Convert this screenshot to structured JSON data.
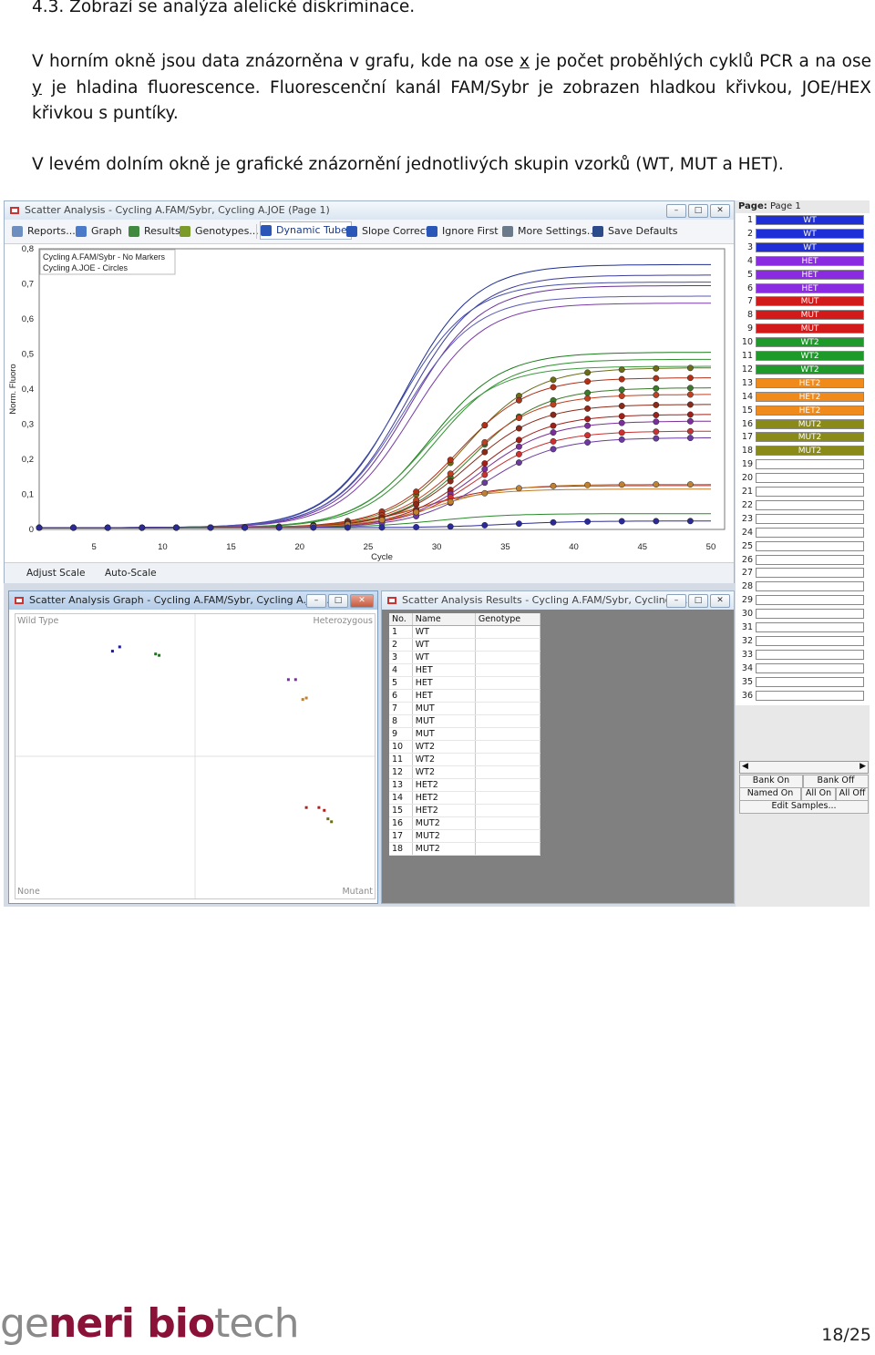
{
  "heading": "4.3.  Zobrazí se analýza alelické diskriminace.",
  "para1": {
    "a": "V horním okně jsou data znázorněna v grafu, kde na ose ",
    "x": "x",
    "b": " je počet proběhlých cyklů PCR a na ose ",
    "y": "y",
    "c": " je hladina fluorescence. Fluorescenční kanál FAM/Sybr je zobrazen hladkou křivkou, JOE/HEX křivkou s puntíky."
  },
  "para2": "V levém dolním okně je grafické znázornění jednotlivých skupin vzorků (WT, MUT a HET).",
  "main_window": {
    "title": "Scatter Analysis - Cycling A.FAM/Sybr, Cycling A.JOE (Page 1)",
    "toolbar": [
      "Reports...",
      "Graph",
      "Results",
      "Genotypes...",
      "Dynamic Tube",
      "Slope Correct",
      "Ignore First",
      "More Settings...",
      "Save Defaults"
    ],
    "legend": [
      "Cycling A.FAM/Sybr - No Markers",
      "Cycling A.JOE - Circles"
    ],
    "adjust_scale": "Adjust Scale",
    "auto_scale": "Auto-Scale"
  },
  "chart_data": {
    "type": "line",
    "xlabel": "Cycle",
    "ylabel": "Norm. Fluoro",
    "xlim": [
      1,
      51
    ],
    "ylim": [
      0,
      0.8
    ],
    "x_ticks": [
      "5",
      "10",
      "15",
      "20",
      "25",
      "30",
      "35",
      "40",
      "45",
      "50"
    ],
    "y_ticks": [
      "0",
      "0,1",
      "0,2",
      "0,3",
      "0,4",
      "0,5",
      "0,6",
      "0,7",
      "0,8"
    ],
    "fam_curves": [
      {
        "color": "#1f2f8f",
        "plateau": 0.75,
        "mid": 27.5
      },
      {
        "color": "#3b3b9a",
        "plateau": 0.72,
        "mid": 27.8
      },
      {
        "color": "#444ea8",
        "plateau": 0.7,
        "mid": 27.2
      },
      {
        "color": "#6a2f9a",
        "plateau": 0.69,
        "mid": 28.0
      },
      {
        "color": "#5a5ab5",
        "plateau": 0.66,
        "mid": 27.6
      },
      {
        "color": "#7a3aa8",
        "plateau": 0.64,
        "mid": 28.2
      },
      {
        "color": "#1a7a1a",
        "plateau": 0.5,
        "mid": 29.5
      },
      {
        "color": "#2f8f2f",
        "plateau": 0.48,
        "mid": 29.8
      },
      {
        "color": "#3d9a3d",
        "plateau": 0.46,
        "mid": 29.2
      },
      {
        "color": "#b02020",
        "plateau": 0.12,
        "mid": 29.0
      },
      {
        "color": "#c07a20",
        "plateau": 0.11,
        "mid": 28.5
      },
      {
        "color": "#2a8a2a",
        "plateau": 0.04,
        "mid": 30.0
      }
    ],
    "joe_curves": [
      {
        "color": "#6b6b18",
        "plateau": 0.48,
        "mid": 32.0
      },
      {
        "color": "#b03018",
        "plateau": 0.45,
        "mid": 31.5
      },
      {
        "color": "#3a7a2a",
        "plateau": 0.42,
        "mid": 32.5
      },
      {
        "color": "#c04020",
        "plateau": 0.4,
        "mid": 32.0
      },
      {
        "color": "#8a2a18",
        "plateau": 0.37,
        "mid": 32.3
      },
      {
        "color": "#a02018",
        "plateau": 0.34,
        "mid": 32.8
      },
      {
        "color": "#7a2f9a",
        "plateau": 0.32,
        "mid": 33.0
      },
      {
        "color": "#cc3030",
        "plateau": 0.29,
        "mid": 33.0
      },
      {
        "color": "#6a3aa0",
        "plateau": 0.27,
        "mid": 33.5
      },
      {
        "color": "#c08030",
        "plateau": 0.13,
        "mid": 30.0
      },
      {
        "color": "#2a2a9a",
        "plateau": 0.02,
        "mid": 35.0
      }
    ]
  },
  "scatter_window": {
    "title": "Scatter Analysis Graph - Cycling A.FAM/Sybr, Cycling A.JOE...",
    "corners": {
      "tl": "Wild Type",
      "tr": "Heterozygous",
      "bl": "None",
      "br": "Mutant"
    },
    "points": [
      {
        "x": 0.27,
        "y": 0.87,
        "color": "#1a1a9a"
      },
      {
        "x": 0.29,
        "y": 0.885,
        "color": "#1a1a9a"
      },
      {
        "x": 0.39,
        "y": 0.86,
        "color": "#1a7a1a"
      },
      {
        "x": 0.4,
        "y": 0.855,
        "color": "#1a7a1a"
      },
      {
        "x": 0.76,
        "y": 0.77,
        "color": "#7a2f9a"
      },
      {
        "x": 0.78,
        "y": 0.77,
        "color": "#7a2f9a"
      },
      {
        "x": 0.8,
        "y": 0.7,
        "color": "#c08030"
      },
      {
        "x": 0.81,
        "y": 0.705,
        "color": "#c08030"
      },
      {
        "x": 0.81,
        "y": 0.32,
        "color": "#b02020"
      },
      {
        "x": 0.845,
        "y": 0.32,
        "color": "#b02020"
      },
      {
        "x": 0.86,
        "y": 0.31,
        "color": "#b02020"
      },
      {
        "x": 0.87,
        "y": 0.28,
        "color": "#6b6b18"
      },
      {
        "x": 0.88,
        "y": 0.27,
        "color": "#6b6b18"
      }
    ]
  },
  "results_window": {
    "title": "Scatter Analysis Results - Cycling A.FAM/Sybr, Cycling A...",
    "headers": [
      "No.",
      "Name",
      "Genotype"
    ],
    "rows": [
      [
        "1",
        "WT",
        ""
      ],
      [
        "2",
        "WT",
        ""
      ],
      [
        "3",
        "WT",
        ""
      ],
      [
        "4",
        "HET",
        ""
      ],
      [
        "5",
        "HET",
        ""
      ],
      [
        "6",
        "HET",
        ""
      ],
      [
        "7",
        "MUT",
        ""
      ],
      [
        "8",
        "MUT",
        ""
      ],
      [
        "9",
        "MUT",
        ""
      ],
      [
        "10",
        "WT2",
        ""
      ],
      [
        "11",
        "WT2",
        ""
      ],
      [
        "12",
        "WT2",
        ""
      ],
      [
        "13",
        "HET2",
        ""
      ],
      [
        "14",
        "HET2",
        ""
      ],
      [
        "15",
        "HET2",
        ""
      ],
      [
        "16",
        "MUT2",
        ""
      ],
      [
        "17",
        "MUT2",
        ""
      ],
      [
        "18",
        "MUT2",
        ""
      ]
    ]
  },
  "sidebar": {
    "page_label": "Page:",
    "page_value": "Page 1",
    "samples": [
      {
        "n": "1",
        "label": "WT",
        "color": "#1e2fd8"
      },
      {
        "n": "2",
        "label": "WT",
        "color": "#1e2fd8"
      },
      {
        "n": "3",
        "label": "WT",
        "color": "#1e2fd8"
      },
      {
        "n": "4",
        "label": "HET",
        "color": "#8a2be2"
      },
      {
        "n": "5",
        "label": "HET",
        "color": "#8a2be2"
      },
      {
        "n": "6",
        "label": "HET",
        "color": "#8a2be2"
      },
      {
        "n": "7",
        "label": "MUT",
        "color": "#d21a1a"
      },
      {
        "n": "8",
        "label": "MUT",
        "color": "#d21a1a"
      },
      {
        "n": "9",
        "label": "MUT",
        "color": "#d21a1a"
      },
      {
        "n": "10",
        "label": "WT2",
        "color": "#1e9a2a"
      },
      {
        "n": "11",
        "label": "WT2",
        "color": "#1e9a2a"
      },
      {
        "n": "12",
        "label": "WT2",
        "color": "#1e9a2a"
      },
      {
        "n": "13",
        "label": "HET2",
        "color": "#f08a1a"
      },
      {
        "n": "14",
        "label": "HET2",
        "color": "#f08a1a"
      },
      {
        "n": "15",
        "label": "HET2",
        "color": "#f08a1a"
      },
      {
        "n": "16",
        "label": "MUT2",
        "color": "#8a8a18"
      },
      {
        "n": "17",
        "label": "MUT2",
        "color": "#8a8a18"
      },
      {
        "n": "18",
        "label": "MUT2",
        "color": "#8a8a18"
      },
      {
        "n": "19",
        "label": "",
        "color": ""
      },
      {
        "n": "20",
        "label": "",
        "color": ""
      },
      {
        "n": "21",
        "label": "",
        "color": ""
      },
      {
        "n": "22",
        "label": "",
        "color": ""
      },
      {
        "n": "23",
        "label": "",
        "color": ""
      },
      {
        "n": "24",
        "label": "",
        "color": ""
      },
      {
        "n": "25",
        "label": "",
        "color": ""
      },
      {
        "n": "26",
        "label": "",
        "color": ""
      },
      {
        "n": "27",
        "label": "",
        "color": ""
      },
      {
        "n": "28",
        "label": "",
        "color": ""
      },
      {
        "n": "29",
        "label": "",
        "color": ""
      },
      {
        "n": "30",
        "label": "",
        "color": ""
      },
      {
        "n": "31",
        "label": "",
        "color": ""
      },
      {
        "n": "32",
        "label": "",
        "color": ""
      },
      {
        "n": "33",
        "label": "",
        "color": ""
      },
      {
        "n": "34",
        "label": "",
        "color": ""
      },
      {
        "n": "35",
        "label": "",
        "color": ""
      },
      {
        "n": "36",
        "label": "",
        "color": ""
      }
    ],
    "buttons": [
      "Bank On",
      "Bank Off",
      "Named On",
      "All On",
      "All Off",
      "Edit Samples..."
    ]
  },
  "footer": {
    "logo_parts": [
      "ge",
      "neri bio",
      "tech"
    ],
    "page": "18/25"
  }
}
